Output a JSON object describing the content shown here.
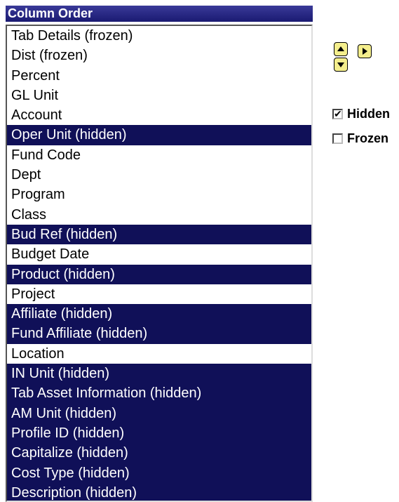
{
  "header": {
    "title": "Column Order"
  },
  "columns": [
    {
      "label": "Tab Details (frozen)",
      "selected": false
    },
    {
      "label": "Dist (frozen)",
      "selected": false
    },
    {
      "label": "Percent",
      "selected": false
    },
    {
      "label": "GL Unit",
      "selected": false
    },
    {
      "label": "Account",
      "selected": false
    },
    {
      "label": "Oper Unit (hidden)",
      "selected": true
    },
    {
      "label": "Fund Code",
      "selected": false
    },
    {
      "label": "Dept",
      "selected": false
    },
    {
      "label": "Program",
      "selected": false
    },
    {
      "label": "Class",
      "selected": false
    },
    {
      "label": "Bud Ref (hidden)",
      "selected": true
    },
    {
      "label": "Budget Date",
      "selected": false
    },
    {
      "label": "Product (hidden)",
      "selected": true
    },
    {
      "label": "Project",
      "selected": false
    },
    {
      "label": "Affiliate (hidden)",
      "selected": true
    },
    {
      "label": "Fund Affiliate (hidden)",
      "selected": true
    },
    {
      "label": "Location",
      "selected": false
    },
    {
      "label": "IN Unit (hidden)",
      "selected": true
    },
    {
      "label": "Tab Asset Information (hidden)",
      "selected": true
    },
    {
      "label": "AM Unit (hidden)",
      "selected": true
    },
    {
      "label": "Profile ID (hidden)",
      "selected": true
    },
    {
      "label": "Capitalize (hidden)",
      "selected": true
    },
    {
      "label": "Cost Type (hidden)",
      "selected": true
    },
    {
      "label": "Description (hidden)",
      "selected": true
    }
  ],
  "controls": {
    "move_up_icon": "arrow-up-icon",
    "move_down_icon": "arrow-down-icon",
    "move_right_icon": "arrow-right-icon"
  },
  "options": {
    "hidden": {
      "label": "Hidden",
      "checked": true
    },
    "frozen": {
      "label": "Frozen",
      "checked": false
    }
  },
  "colors": {
    "selected_bg": "#101058",
    "header_bg": "#1a1a72",
    "button_bg": "#f4ee8c"
  }
}
